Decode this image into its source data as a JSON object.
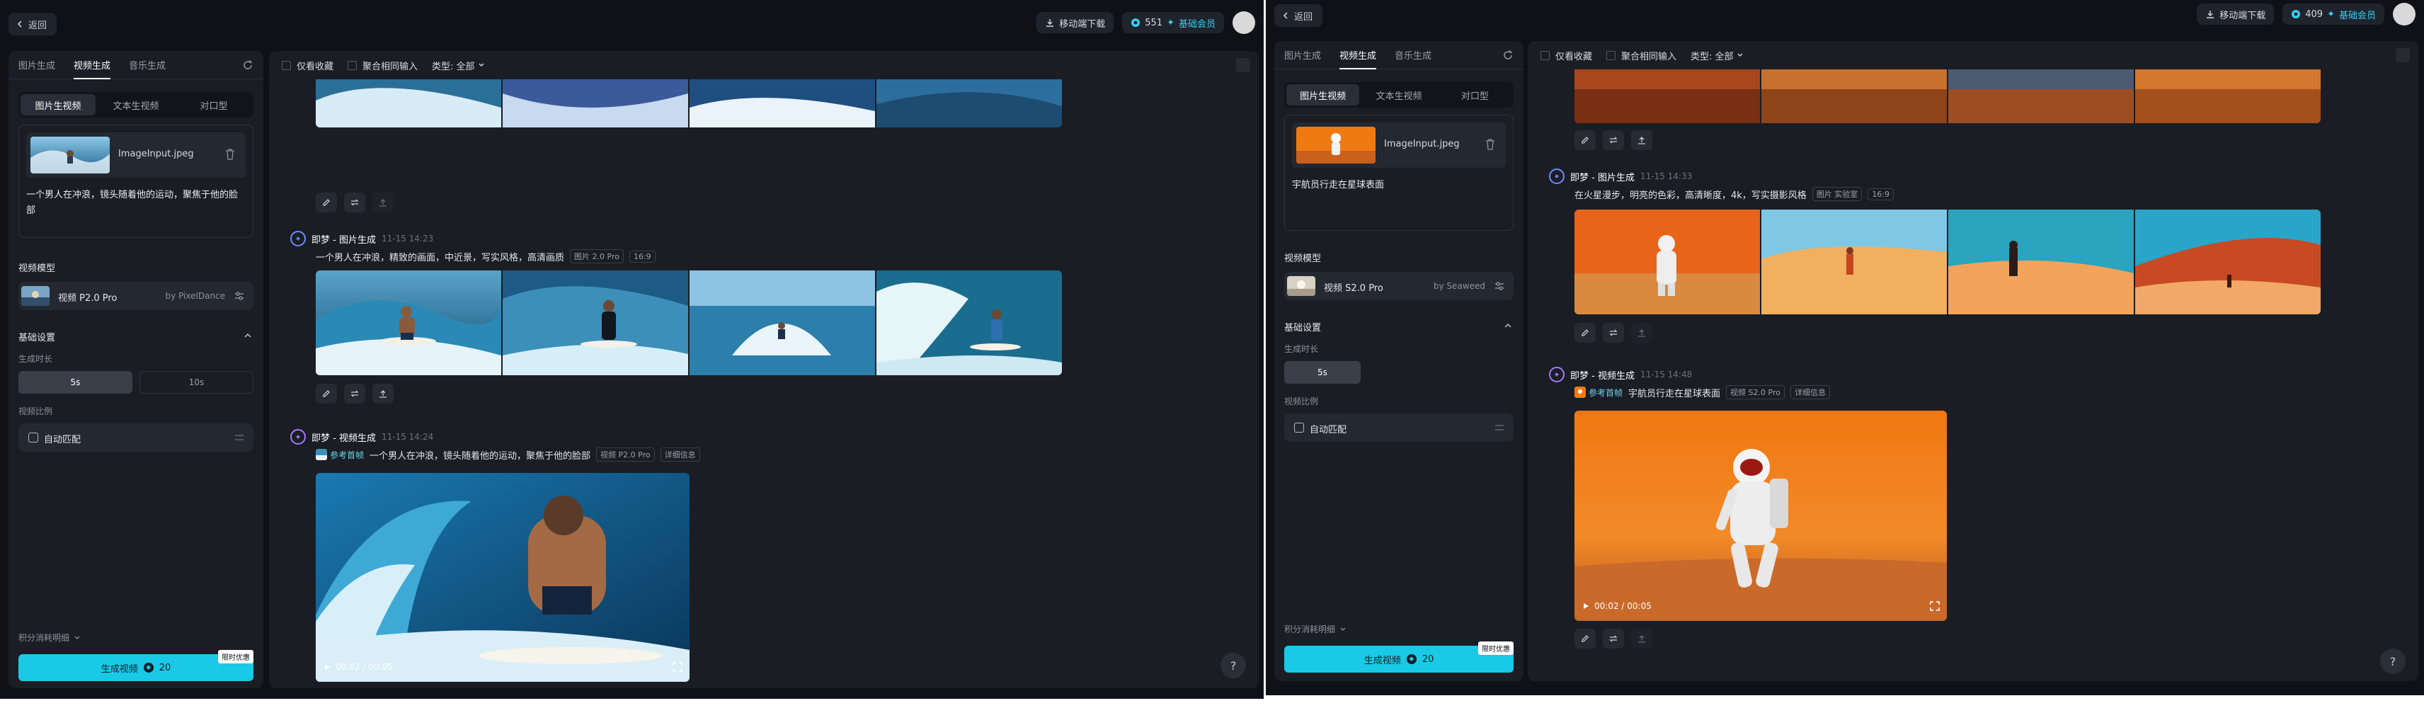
{
  "left": {
    "header": {
      "back_label": "返回",
      "download_label": "移动端下载",
      "credits": "551",
      "member_label": "基础会员"
    },
    "sidebar": {
      "tabs": [
        "图片生成",
        "视频生成",
        "音乐生成"
      ],
      "modes": [
        "图片生视频",
        "文本生视频",
        "对口型"
      ],
      "file_name": "ImageInput.jpeg",
      "prompt": "一个男人在冲浪，镜头随着他的运动，聚焦于他的脸部",
      "model_section": "视频模型",
      "model_name": "视频 P2.0 Pro",
      "model_by": "by PixelDance",
      "basic_settings": "基础设置",
      "duration_label": "生成时长",
      "durations": [
        "5s",
        "10s"
      ],
      "ratio_label": "视频比例",
      "ratio_value": "自动匹配",
      "credits_detail": "积分消耗明细",
      "generate_label": "生成视频",
      "generate_cost": "20",
      "promo": "限时优惠"
    },
    "main": {
      "filter_favorites": "仅看收藏",
      "filter_same_input": "聚合相同输入",
      "filter_type": "类型: 全部",
      "image_gen": {
        "title": "即梦 - 图片生成",
        "time": "11-15  14:23",
        "prompt": "一个男人在冲浪，精致的画面，中近景，写实风格，高清画质",
        "model_tag": "图片 2.0 Pro",
        "ratio_tag": "16:9"
      },
      "video_gen": {
        "title": "即梦 - 视频生成",
        "time": "11-15  14:24",
        "ref_label": "参考首帧",
        "prompt": "一个男人在冲浪，镜头随着他的运动，聚焦于他的脸部",
        "model_tag": "视频 P2.0 Pro",
        "detail_tag": "详细信息",
        "duration": "00:02 / 00:05"
      }
    }
  },
  "right": {
    "header": {
      "back_label": "返回",
      "download_label": "移动端下载",
      "credits": "409",
      "member_label": "基础会员"
    },
    "sidebar": {
      "tabs": [
        "图片生成",
        "视频生成",
        "音乐生成"
      ],
      "modes": [
        "图片生视频",
        "文本生视频",
        "对口型"
      ],
      "file_name": "ImageInput.jpeg",
      "prompt": "宇航员行走在星球表面",
      "model_section": "视频模型",
      "model_name": "视频 S2.0 Pro",
      "model_by": "by Seaweed",
      "basic_settings": "基础设置",
      "duration_label": "生成时长",
      "durations": [
        "5s"
      ],
      "ratio_label": "视频比例",
      "ratio_value": "自动匹配",
      "credits_detail": "积分消耗明细",
      "generate_label": "生成视频",
      "generate_cost": "20",
      "promo": "限时优惠"
    },
    "main": {
      "filter_favorites": "仅看收藏",
      "filter_same_input": "聚合相同输入",
      "filter_type": "类型: 全部",
      "image_gen": {
        "title": "即梦 - 图片生成",
        "time": "11-15  14:33",
        "prompt": "在火星漫步，明亮的色彩，高清晰度，4k，写实摄影风格",
        "model_tag": "图片 实验室",
        "ratio_tag": "16:9"
      },
      "video_gen": {
        "title": "即梦 - 视频生成",
        "time": "11-15  14:48",
        "ref_label": "参考首帧",
        "prompt": "宇航员行走在星球表面",
        "model_tag": "视频 S2.0 Pro",
        "detail_tag": "详细信息",
        "duration": "00:02 / 00:05"
      }
    }
  },
  "icons": [
    "chevron-left-icon",
    "download-icon",
    "coin-icon",
    "plus-icon",
    "refresh-icon",
    "trash-icon",
    "sliders-icon",
    "chevron-up-icon",
    "chevron-down-icon",
    "ratio-icon",
    "edit-icon",
    "remix-icon",
    "upload-icon",
    "play-icon",
    "fullscreen-icon",
    "help-icon",
    "collapse-icon"
  ],
  "colors": {
    "accent": "#1ac9e6",
    "background": "#0f1116",
    "panel": "#1a1d24",
    "card": "#242831"
  }
}
